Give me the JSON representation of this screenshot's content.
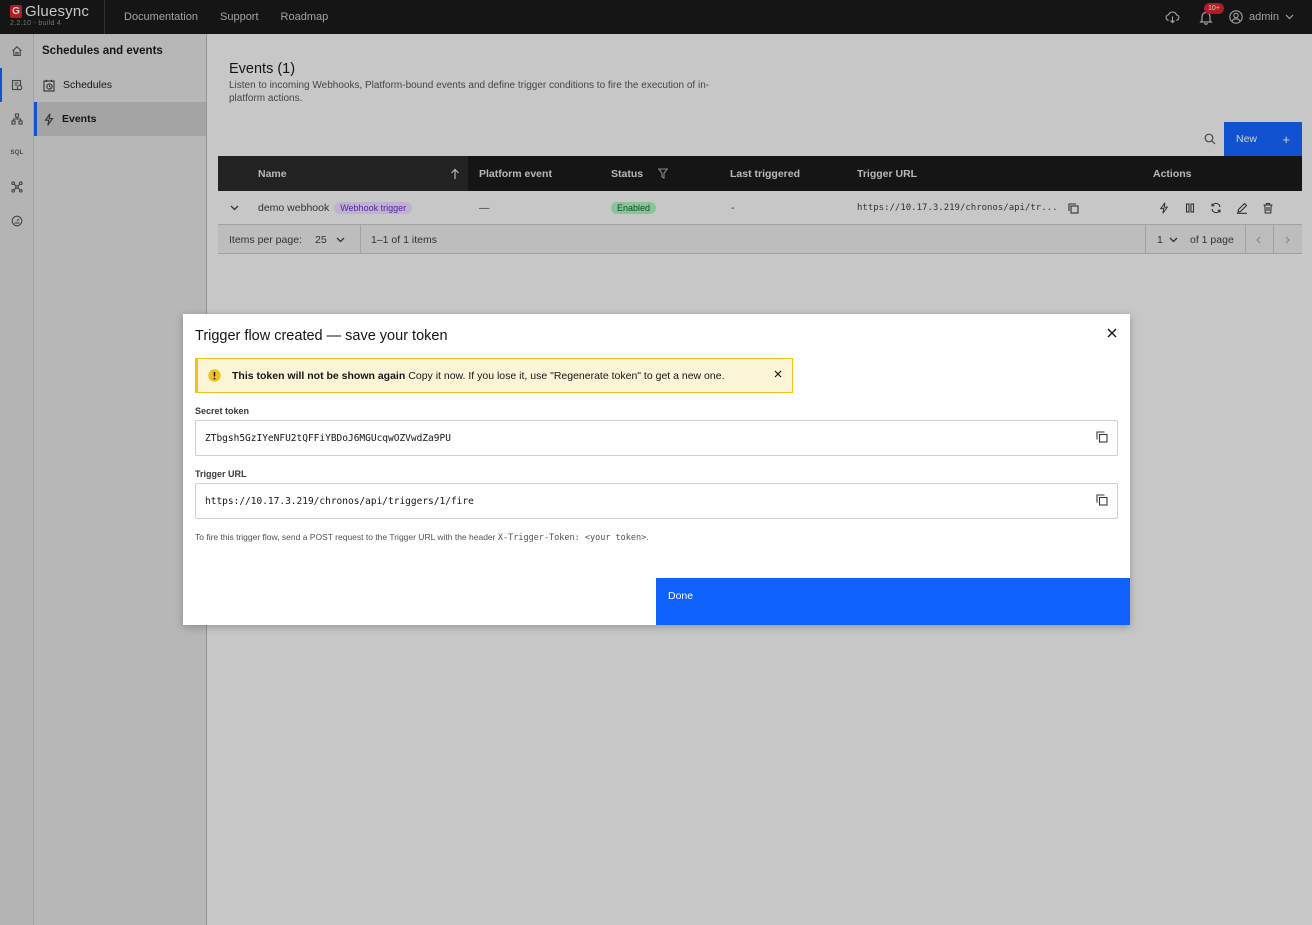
{
  "topbar": {
    "brand_name": "Gluesync",
    "brand_logo_letter": "G",
    "version": "2.2.10 - build 4",
    "nav": [
      "Documentation",
      "Support",
      "Roadmap"
    ],
    "notifications_badge": "10+",
    "user": "admin"
  },
  "rail": {
    "icons": [
      "home-icon",
      "schedules-icon",
      "pipelines-icon",
      "sql-icon",
      "connectors-icon",
      "monitor-icon"
    ],
    "sql_label": "SQL"
  },
  "side": {
    "title": "Schedules and events",
    "items": [
      {
        "label": "Schedules",
        "icon": "calendar-clock-icon"
      },
      {
        "label": "Events",
        "icon": "lightning-icon"
      }
    ]
  },
  "events": {
    "title": "Events (1)",
    "description": "Listen to incoming Webhooks, Platform-bound events and define trigger conditions to fire the execution of in-platform actions.",
    "new_button": "New",
    "new_plus": "+",
    "columns": [
      "Name",
      "Platform event",
      "Status",
      "Last triggered",
      "Trigger URL",
      "Actions"
    ],
    "rows": [
      {
        "name": "demo webhook",
        "tag": "Webhook trigger",
        "platform_event": "—",
        "status": "Enabled",
        "last_triggered": "-",
        "trigger_url": "https://10.17.3.219/chronos/api/tr..."
      }
    ],
    "pagination": {
      "items_per_page_label": "Items per page:",
      "items_per_page": "25",
      "range": "1–1 of 1 items",
      "page": "1",
      "of_pages": "of 1 page"
    }
  },
  "modal": {
    "title": "Trigger flow created — save your token",
    "warning_title": "This token will not be shown again",
    "warning_text": "Copy it now. If you lose it, use \"Regenerate token\" to get a new one.",
    "secret_label": "Secret token",
    "secret_value": "ZTbgsh5GzIYeNFU2tQFFiYBDoJ6MGUcqwOZVwdZa9PU",
    "url_label": "Trigger URL",
    "url_value": "https://10.17.3.219/chronos/api/triggers/1/fire",
    "help_prefix": "To fire this trigger flow, send a POST request to the Trigger URL with the header ",
    "help_code": "X-Trigger-Token: <your token>",
    "help_suffix": ".",
    "done_button": "Done"
  },
  "colors": {
    "accent": "#0f62fe",
    "topbar": "#161616",
    "warning_bg": "#fcf4d6",
    "warning_border": "#f1c21b",
    "enabled_tag": "#a7f0ba",
    "webhook_tag": "#e8daff"
  }
}
